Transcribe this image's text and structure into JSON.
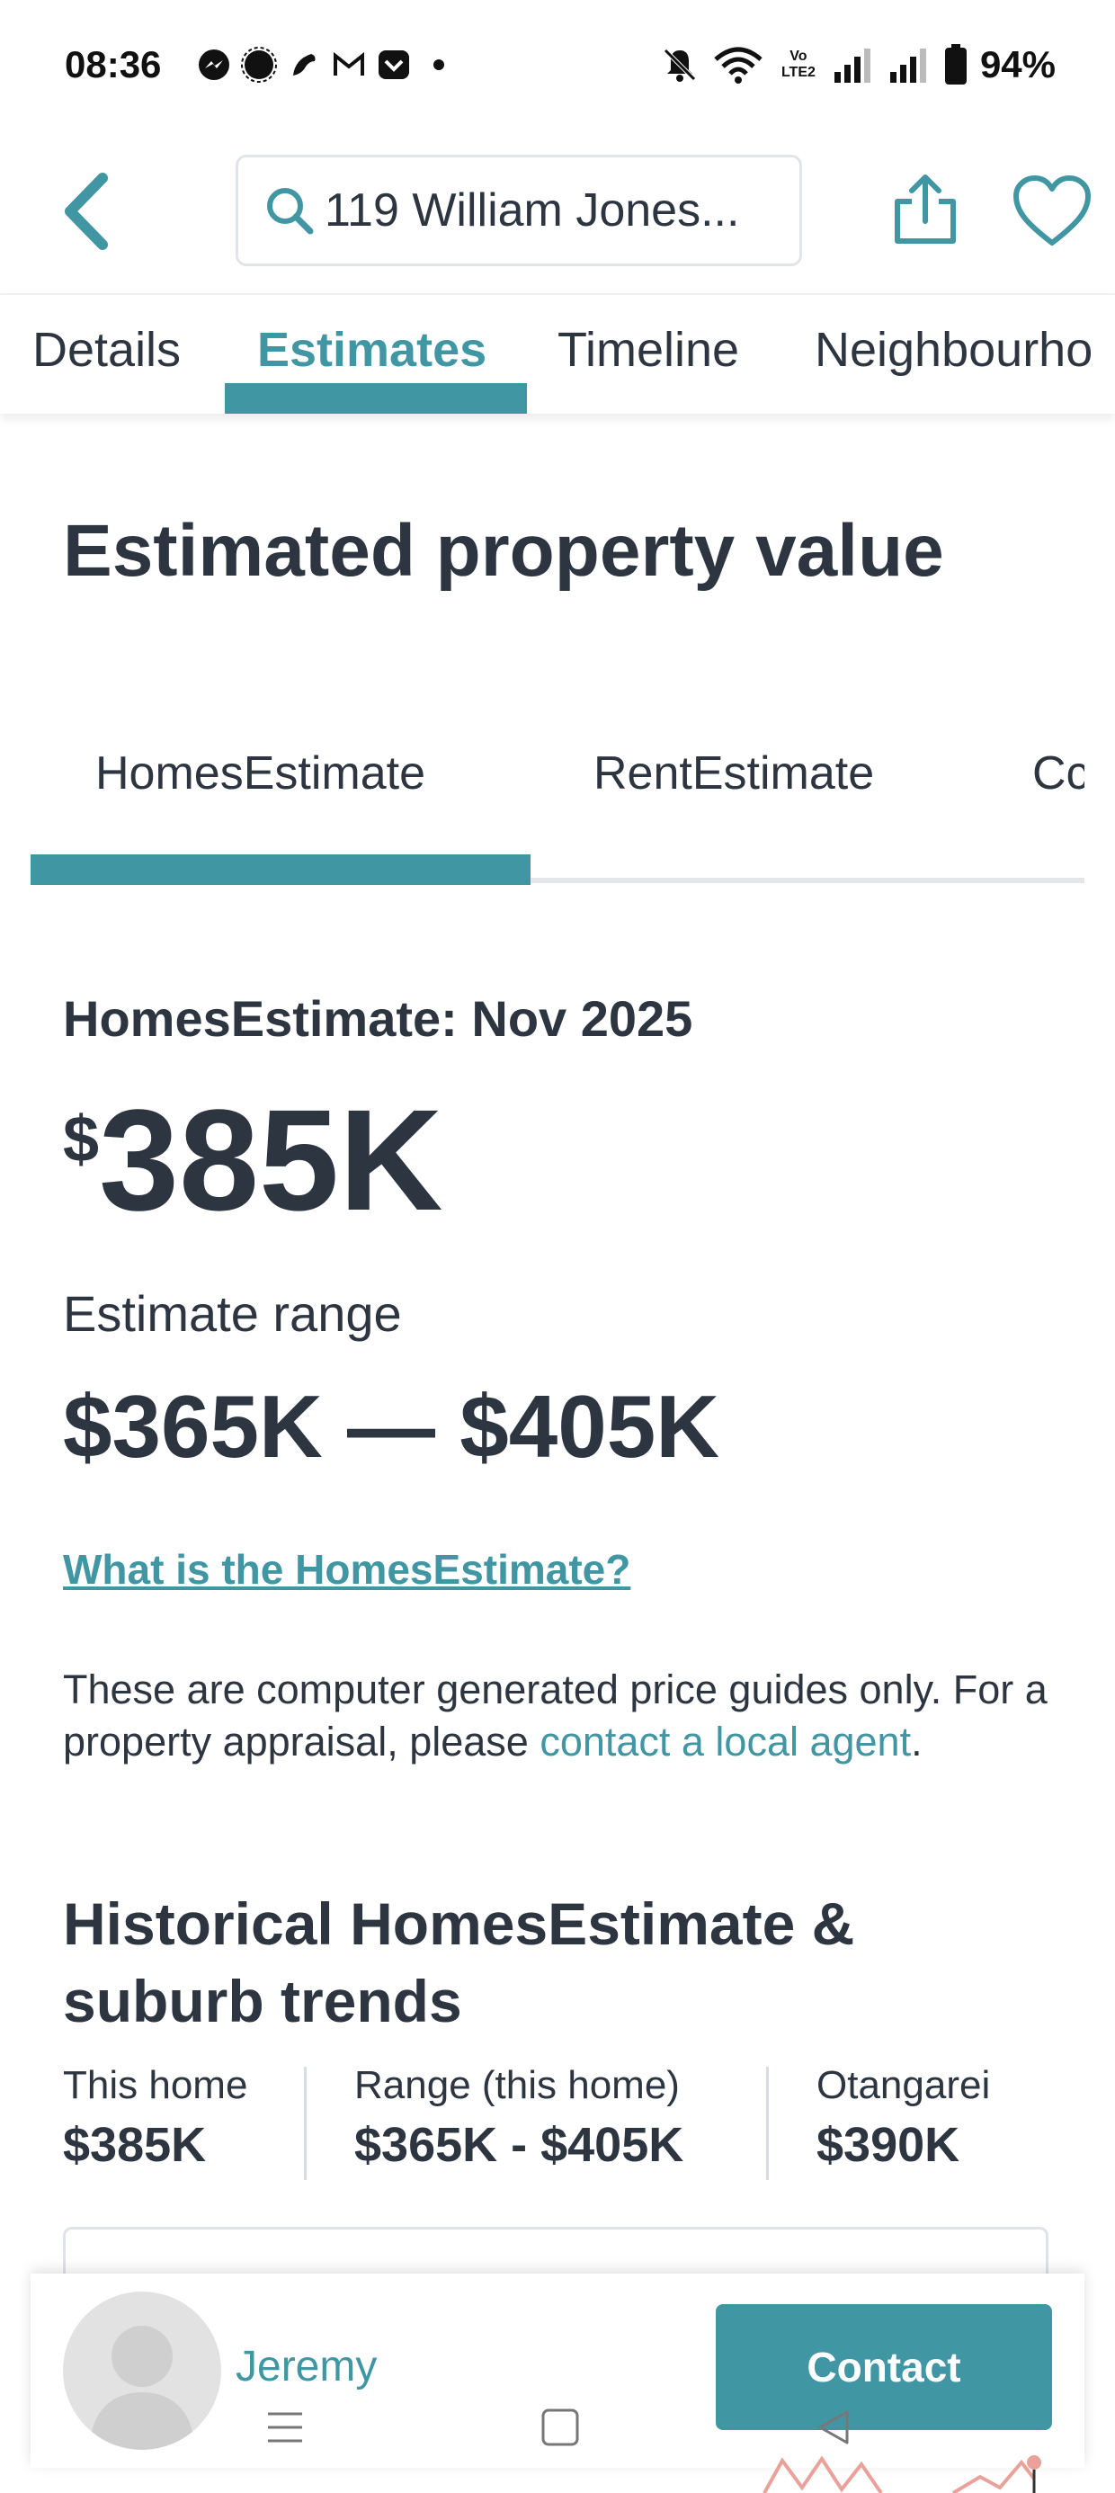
{
  "status_bar": {
    "time": "08:36",
    "battery": "94%",
    "network_label": "Vo LTE2"
  },
  "header": {
    "search_value": "119 William Jones...",
    "icons": [
      "back-arrow-icon",
      "search-icon",
      "share-icon",
      "heart-icon"
    ]
  },
  "top_tabs": {
    "items": [
      "Details",
      "Estimates",
      "Timeline",
      "Neighbourho"
    ],
    "active": "Estimates"
  },
  "page_title": "Estimated property value",
  "estimate_tabs": {
    "items": [
      "HomesEstimate",
      "RentEstimate",
      "Cc"
    ],
    "active": "HomesEstimate"
  },
  "estimate": {
    "heading": "HomesEstimate: Nov 2025",
    "currency": "$",
    "value": "385K",
    "range_label": "Estimate range",
    "range_value": "$365K — $405K",
    "what_link": "What is the HomesEstimate?",
    "disclaimer_text": "These are computer generated price guides only. For a property appraisal, please ",
    "disclaimer_link": "contact a local agent",
    "disclaimer_end": "."
  },
  "historical": {
    "title": "Historical HomesEstimate & suburb trends",
    "stats": [
      {
        "label": "This home",
        "value": "$385K"
      },
      {
        "label": "Range (this home)",
        "value": "$365K - $405K"
      },
      {
        "label": "Otangarei",
        "value": "$390K"
      }
    ]
  },
  "contact_bar": {
    "agent_name": "Jeremy",
    "button_label": "Contact"
  },
  "colors": {
    "accent": "#4196a3",
    "text": "#2d3541"
  }
}
